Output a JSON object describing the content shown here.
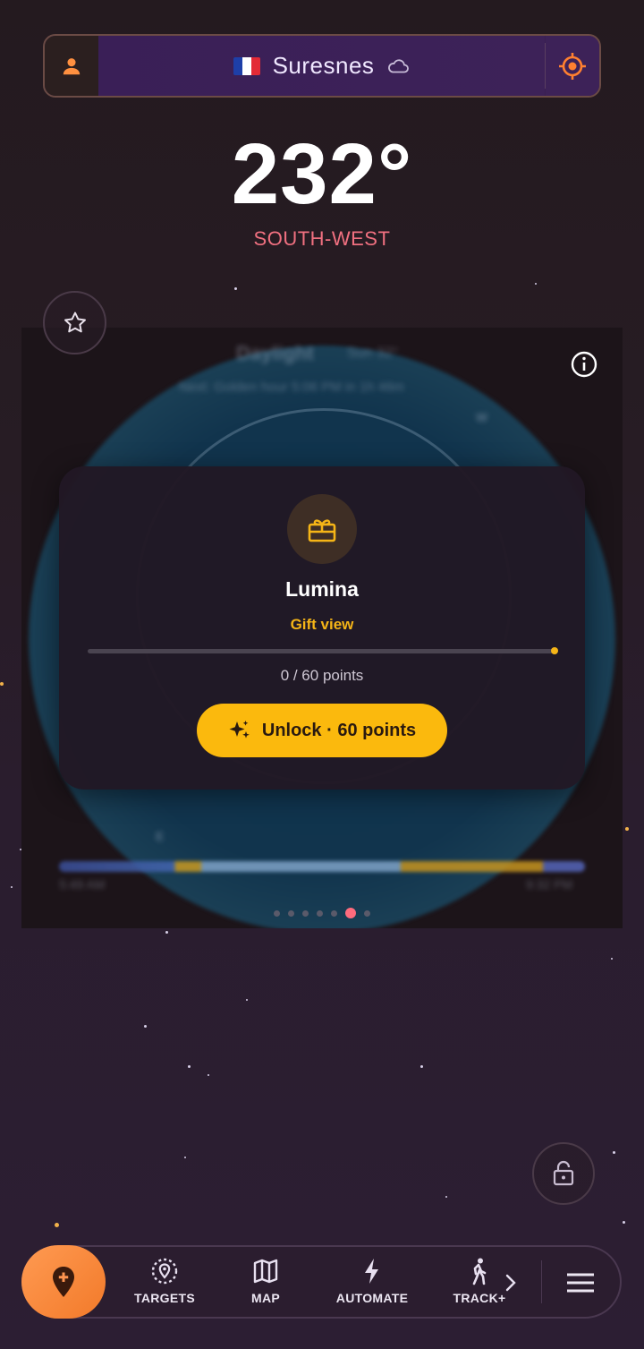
{
  "topbar": {
    "city": "Suresnes",
    "country_flag": "france-flag",
    "weather_icon": "cloud-icon",
    "accent_color": "#f27a2a"
  },
  "compass": {
    "heading": "232°",
    "direction": "SOUTH-WEST"
  },
  "dial": {
    "blurred_title": "Daylight",
    "blurred_sun": "Sun 32°",
    "blurred_next": "Next: Golden hour 5:06 PM in 1h 46m",
    "compass_w": "W",
    "compass_e": "E",
    "sunrise": "5:49 AM",
    "sunset": "9:32 PM",
    "page_count": 7,
    "active_page": 6
  },
  "card": {
    "title": "Lumina",
    "subtitle": "Gift view",
    "points_text": "0 / 60 points",
    "progress_fraction": 0,
    "unlock_label": "Unlock · 60 points"
  },
  "nav": {
    "items": [
      {
        "label": "TARGETS",
        "icon": "target-pin-icon"
      },
      {
        "label": "MAP",
        "icon": "map-icon"
      },
      {
        "label": "AUTOMATE",
        "icon": "bolt-icon"
      },
      {
        "label": "TRACK+",
        "icon": "walk-icon"
      }
    ]
  }
}
